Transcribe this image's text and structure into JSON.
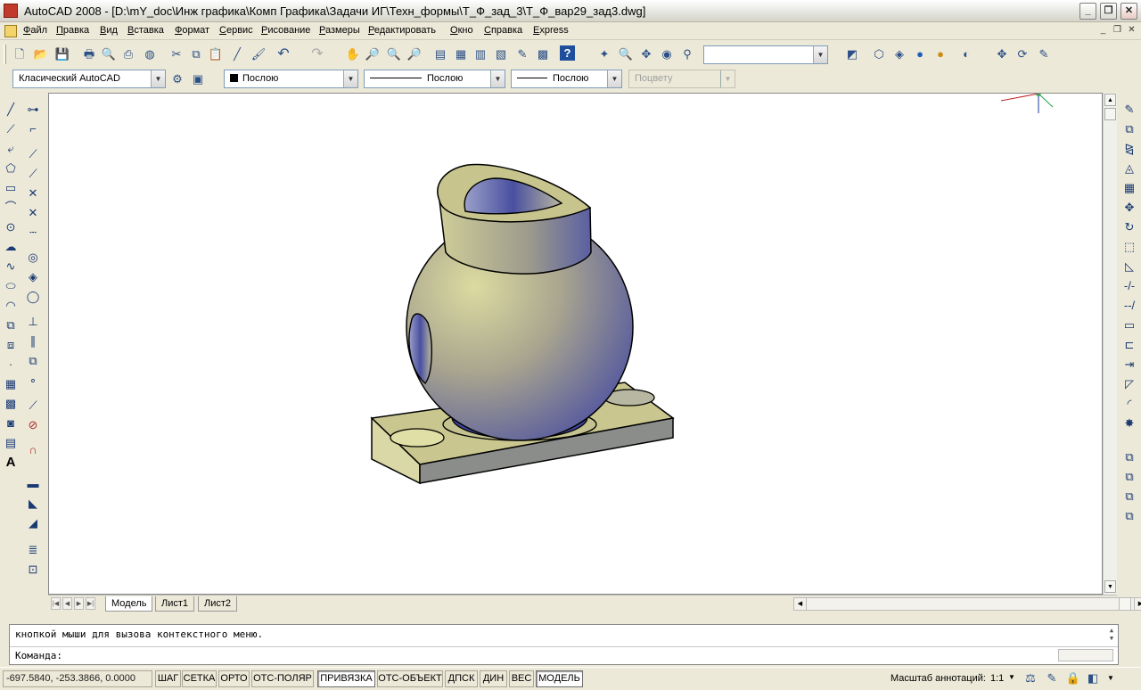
{
  "window": {
    "title": "AutoCAD 2008 - [D:\\mY_doc\\Инж графика\\Комп Графика\\Задачи ИГ\\Техн_формы\\Т_Ф_зад_3\\Т_Ф_вар29_зад3.dwg]",
    "minimize": "_",
    "restore": "❐",
    "close": "✕"
  },
  "menu": {
    "items": [
      "Файл",
      "Правка",
      "Вид",
      "Вставка",
      "Формат",
      "Сервис",
      "Рисование",
      "Размеры",
      "Редактировать",
      "Окно",
      "Справка",
      "Express"
    ],
    "doc_minimize": "_",
    "doc_restore": "❐",
    "doc_close": "✕"
  },
  "toolbar": {
    "standard_icons": [
      "new-icon",
      "open-icon",
      "save-icon",
      "print-icon",
      "preview-icon",
      "publish-icon",
      "plot-icon",
      "cut-icon",
      "copy-icon",
      "paste-icon",
      "match-icon",
      "brush-icon",
      "undo-icon",
      "redo-icon",
      "pan-icon",
      "zoom-realtime-icon",
      "zoom-window-icon",
      "zoom-previous-icon",
      "properties-icon",
      "design-center-icon",
      "tool-palettes-icon",
      "sheet-set-icon",
      "markup-icon",
      "quickcalc-icon",
      "help-icon"
    ],
    "view_combo": "",
    "workspace": "Класический AutoCAD",
    "color": "Послою",
    "linetype": "Послою",
    "lineweight": "Послою",
    "plotstyle": "Поцвету"
  },
  "drawing": {
    "model_colors": {
      "shade_light": "#dcdba0",
      "shade_dark": "#4a4fa0",
      "base": "#c9c68f",
      "edge": "#000000"
    }
  },
  "tabs": {
    "items": [
      "Модель",
      "Лист1",
      "Лист2"
    ],
    "active": "Модель"
  },
  "command": {
    "line1": "кнопкой мыши для вызова контекстного меню.",
    "prompt": "Команда:"
  },
  "status": {
    "coordinates": "-697.5840, -253.3866, 0.0000",
    "buttons": [
      {
        "label": "ШАГ",
        "on": false
      },
      {
        "label": "СЕТКА",
        "on": false
      },
      {
        "label": "ОРТО",
        "on": false
      },
      {
        "label": "ОТС-ПОЛЯР",
        "on": false
      },
      {
        "label": "ПРИВЯЗКА",
        "on": true
      },
      {
        "label": "ОТС-ОБЪЕКТ",
        "on": false
      },
      {
        "label": "ДПСК",
        "on": false
      },
      {
        "label": "ДИН",
        "on": false
      },
      {
        "label": "ВЕС",
        "on": false
      },
      {
        "label": "МОДЕЛЬ",
        "on": true
      }
    ],
    "annotation_scale_label": "Масштаб аннотаций:",
    "annotation_scale": "1:1"
  },
  "colors": {
    "accent": "#0a246a",
    "window_bg": "#ece9d8"
  }
}
